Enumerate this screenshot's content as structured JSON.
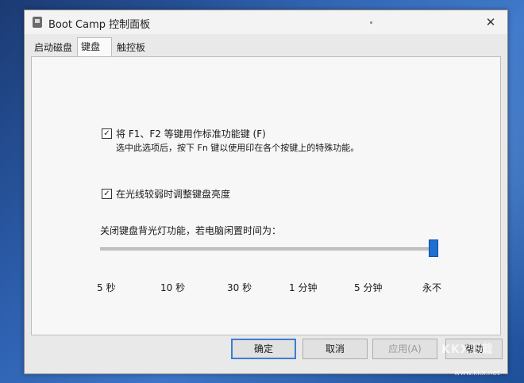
{
  "window": {
    "title": "Boot Camp 控制面板",
    "close_label": "✕"
  },
  "tabs": [
    {
      "label": "启动磁盘"
    },
    {
      "label": "键盘",
      "selected": true
    },
    {
      "label": "触控板"
    }
  ],
  "options": {
    "function_keys": {
      "checked": true,
      "label": "将 F1、F2 等键用作标准功能键 (F)",
      "description": "选中此选项后，按下 Fn 键以使用印在各个按键上的特殊功能。"
    },
    "brightness": {
      "checked": true,
      "label": "在光线较弱时调整键盘亮度"
    }
  },
  "backlight": {
    "label": "关闭键盘背光灯功能，若电脑闲置时间为：",
    "ticks": [
      "5 秒",
      "10 秒",
      "30 秒",
      "1 分钟",
      "5 分钟",
      "永不"
    ],
    "selected": "永不"
  },
  "buttons": {
    "ok": "确定",
    "cancel": "取消",
    "apply": "应用(A)",
    "help": "帮助"
  },
  "watermark": {
    "main": "KKX下载",
    "small": "www.kkx.net"
  },
  "colors": {
    "accent": "#1e6fd0"
  }
}
